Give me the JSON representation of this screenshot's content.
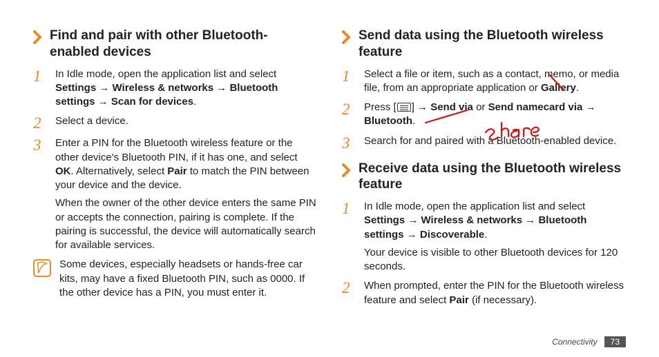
{
  "left": {
    "heading": "Find and pair with other Bluetooth-enabled devices",
    "steps": [
      {
        "num": "1",
        "html": "In Idle mode, open the application list and select <b>Settings</b> → <b>Wireless & networks</b> → <b>Bluetooth settings</b> → <b>Scan for devices</b>."
      },
      {
        "num": "2",
        "html": "Select a device."
      },
      {
        "num": "3",
        "html": "Enter a PIN for the Bluetooth wireless feature or the other device's Bluetooth PIN, if it has one, and select <b>OK</b>. Alternatively, select <b>Pair</b> to match the PIN between your device and the device.",
        "sub": "When the owner of the other device enters the same PIN or accepts the connection, pairing is complete. If the pairing is successful, the device will automatically search for available services."
      }
    ],
    "note": "Some devices, especially headsets or hands-free car kits, may have a fixed Bluetooth PIN, such as 0000. If the other device has a PIN, you must enter it."
  },
  "right": {
    "sections": [
      {
        "heading": "Send data using the Bluetooth wireless feature",
        "steps": [
          {
            "num": "1",
            "html": "Select a file or item, such as a contact, memo, or media file, from an appropriate application or <b>Gallery</b>."
          },
          {
            "num": "2",
            "html": "Press [<span class=\"menu-icon\" data-name=\"menu-key-icon\" data-interactable=\"false\"></span>] → <b>Send via</b> or <b>Send namecard via</b> → <b>Bluetooth</b>."
          },
          {
            "num": "3",
            "html": "Search for and paired with a Bluetooth-enabled device."
          }
        ]
      },
      {
        "heading": "Receive data using the Bluetooth wireless feature",
        "steps": [
          {
            "num": "1",
            "html": "In Idle mode, open the application list and select <b>Settings</b> → <b>Wireless & networks</b> → <b>Bluetooth settings</b> → <b>Discoverable</b>.",
            "sub": "Your device is visible to other Bluetooth devices for 120 seconds."
          },
          {
            "num": "2",
            "html": "When prompted, enter the PIN for the Bluetooth wireless feature and select <b>Pair</b> (if necessary)."
          }
        ]
      }
    ]
  },
  "footer": {
    "category": "Connectivity",
    "page": "73"
  },
  "annotations": {
    "memo_strike": true,
    "sendvia_strike": true,
    "share_text": "share"
  }
}
